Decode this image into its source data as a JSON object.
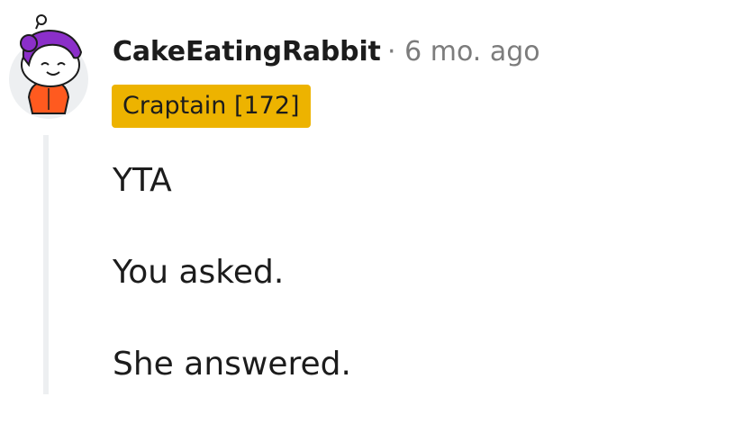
{
  "comment": {
    "author": "CakeEatingRabbit",
    "separator": "·",
    "timestamp": "6 mo. ago",
    "flair": "Craptain [172]",
    "flair_color": "#edb300",
    "avatar_icon": "snoo-avatar-icon",
    "paragraphs": [
      "YTA",
      "You asked.",
      "She answered."
    ]
  }
}
